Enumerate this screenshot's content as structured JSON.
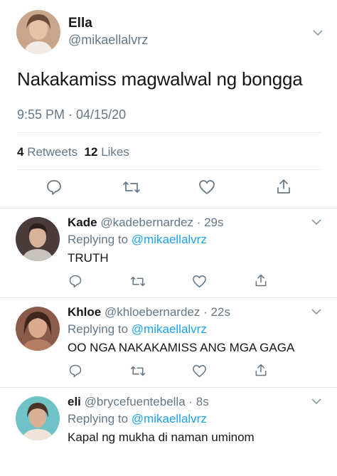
{
  "main_tweet": {
    "name": "Ella",
    "handle": "@mikaellalvrz",
    "text": "Nakakamiss magwalwal ng bongga",
    "timestamp": "9:55 PM · 04/15/20",
    "retweets_count": "4",
    "retweets_label": "Retweets",
    "likes_count": "12",
    "likes_label": "Likes"
  },
  "replies": [
    {
      "name": "Kade",
      "handle": "@kadebernardez",
      "time": "· 29s",
      "replying_prefix": "Replying to",
      "replying_to": "@mikaellalvrz",
      "text": "TRUTH"
    },
    {
      "name": "Khloe",
      "handle": "@khloebernardez",
      "time": "· 22s",
      "replying_prefix": "Replying to",
      "replying_to": "@mikaellalvrz",
      "text": "OO NGA NAKAKAMISS ANG MGA GAGA"
    },
    {
      "name": "eli",
      "handle": "@brycefuentebella",
      "time": "· 8s",
      "replying_prefix": "Replying to",
      "replying_to": "@mikaellalvrz",
      "text": "Kapal ng mukha di naman uminom"
    }
  ],
  "icons": [
    "reply-icon",
    "retweet-icon",
    "like-icon",
    "share-icon",
    "chevron-down-icon"
  ],
  "colors": {
    "text": "#14171a",
    "secondary": "#657786",
    "link": "#1da1f2",
    "divider": "#e6ecf0"
  }
}
